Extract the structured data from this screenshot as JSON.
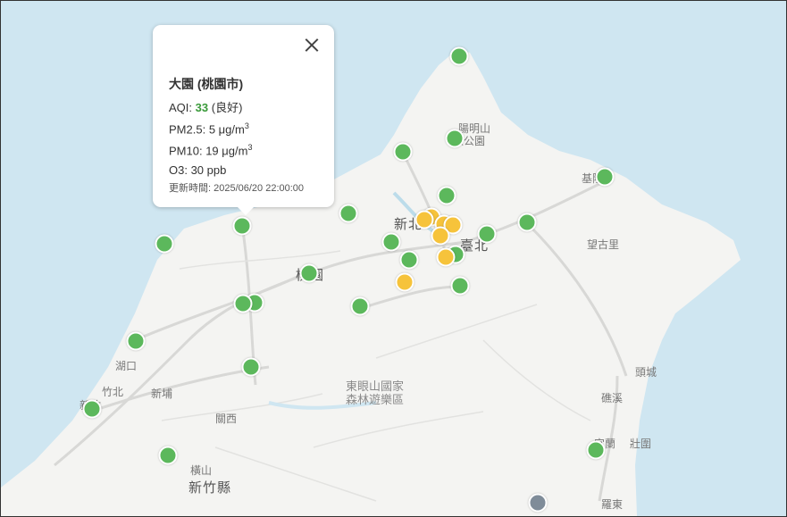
{
  "popup": {
    "station": "大園 (桃園市)",
    "aqi_label": "AQI:",
    "aqi_value": "33",
    "aqi_status": "(良好)",
    "pm25_label": "PM2.5:",
    "pm25_value": "5 μg/m",
    "pm25_unit_exp": "3",
    "pm10_label": "PM10:",
    "pm10_value": "19 μg/m",
    "pm10_unit_exp": "3",
    "o3": "O3: 30 ppb",
    "updated": "更新時間: 2025/06/20 22:00:00"
  },
  "places": {
    "yangmingshan_1": "陽明山",
    "yangmingshan_2": "家公園",
    "keelung": "基隆",
    "xinbei": "新北",
    "taipei": "臺北",
    "wanggu": "望古里",
    "taoyuan": "桃園",
    "hukou": "湖口",
    "zhubei": "竹北",
    "xinpu": "新埔",
    "guanxi": "關西",
    "hsinchu": "新竹",
    "hengshan": "橫山",
    "hsinchu_county": "新竹縣",
    "dongyanshan_1": "東眼山國家",
    "dongyanshan_2": "森林遊樂區",
    "toucheng": "頭城",
    "jiaoxi": "礁溪",
    "yilan": "宜蘭",
    "zhuangwei": "壯圍",
    "luodong": "羅東"
  },
  "legend_colors": {
    "good": "#5cb85c",
    "moderate": "#f6c33b",
    "offline": "#7f8c99"
  },
  "stations": [
    {
      "status": "good"
    },
    {
      "status": "good"
    },
    {
      "status": "good"
    },
    {
      "status": "good"
    },
    {
      "status": "good"
    },
    {
      "status": "good"
    },
    {
      "status": "good"
    },
    {
      "status": "good"
    },
    {
      "status": "good"
    },
    {
      "status": "good"
    },
    {
      "status": "good"
    },
    {
      "status": "good"
    },
    {
      "status": "good"
    },
    {
      "status": "good"
    },
    {
      "status": "good"
    },
    {
      "status": "good"
    },
    {
      "status": "good"
    },
    {
      "status": "good"
    },
    {
      "status": "good"
    },
    {
      "status": "good"
    },
    {
      "status": "good"
    },
    {
      "status": "good"
    },
    {
      "status": "good"
    },
    {
      "status": "moderate"
    },
    {
      "status": "moderate"
    },
    {
      "status": "moderate"
    },
    {
      "status": "moderate"
    },
    {
      "status": "moderate"
    },
    {
      "status": "moderate"
    },
    {
      "status": "moderate"
    },
    {
      "status": "offline"
    }
  ]
}
